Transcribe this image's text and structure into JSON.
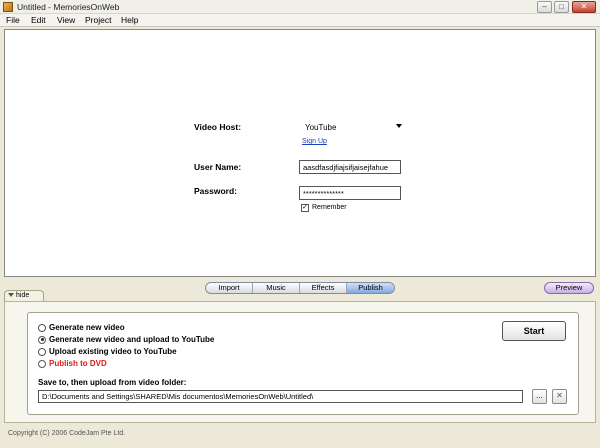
{
  "window": {
    "title": "Untitled - MemoriesOnWeb",
    "minimize_glyph": "–",
    "maximize_glyph": "□",
    "close_glyph": "✕"
  },
  "menu": [
    "File",
    "Edit",
    "View",
    "Project",
    "Help"
  ],
  "form": {
    "video_host_label": "Video Host:",
    "video_host_value": "YouTube",
    "sign_up_link": "Sign Up",
    "username_label": "User Name:",
    "username_value": "aasdfasdjfiajsifjaisejfahue",
    "password_label": "Password:",
    "password_value": "**************",
    "remember_label": "Remember",
    "remember_checked": true
  },
  "tabs": [
    "Import",
    "Music",
    "Effects",
    "Publish"
  ],
  "active_tab": "Publish",
  "preview_label": "Preview",
  "hide_label": "hide",
  "options": {
    "generate_new": "Generate new video",
    "generate_upload": "Generate new video and upload to YouTube",
    "upload_existing": "Upload existing video to YouTube",
    "publish_dvd": "Publish to DVD",
    "selected": "generate_upload"
  },
  "start_label": "Start",
  "save_label": "Save to, then upload from video folder:",
  "save_path": "D:\\Documents and Settings\\SHARED\\Mis documentos\\MemoriesOnWeb\\Untitled\\",
  "browse_label": "...",
  "clear_glyph": "✕",
  "copyright": "Copyright (C) 2006 CodeJam Pte Ltd.",
  "colors": {
    "dvd_option": "#d91a1a",
    "link": "#1a3fbf"
  },
  "icons": {
    "app": "film-reel-icon",
    "dropdown": "chevron-down-icon",
    "hide": "triangle-down-icon",
    "clear": "close-icon"
  }
}
